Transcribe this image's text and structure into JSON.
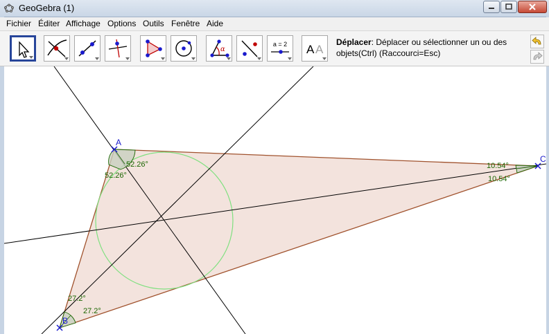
{
  "window": {
    "title": "GeoGebra (1)"
  },
  "menu": {
    "fichier": "Fichier",
    "editer": "Éditer",
    "affichage": "Affichage",
    "options": "Options",
    "outils": "Outils",
    "fenetre": "Fenêtre",
    "aide": "Aide"
  },
  "toolbar": {
    "text_tool_glyph_1": "A",
    "text_tool_glyph_2": "A",
    "slider_tool_label": "a = 2",
    "tool_help_title": "Déplacer",
    "tool_help_text": ": Déplacer ou sélectionner un ou des objets(Ctrl) (Raccourci=Esc)"
  },
  "geometry": {
    "points": {
      "A": "A",
      "B": "B",
      "C": "C"
    },
    "angles": {
      "A_1": "52.26°",
      "A_2": "52.26°",
      "B_1": "27.2°",
      "B_2": "27.2°",
      "C_1": "10.54°",
      "C_2": "10.54°"
    },
    "colors": {
      "triangle_fill": "#f3e3dd",
      "triangle_edge": "#a0522d",
      "incircle": "#7fe07f",
      "bisector": "#000000",
      "point": "#1a1acc",
      "angle_label": "#1a6600",
      "angle_fill": "#c8cfc0"
    }
  },
  "icons": {
    "move": "arrow-cursor-icon",
    "point": "point-intersection-icon",
    "line": "line-through-points-icon",
    "perpendicular": "perpendicular-line-icon",
    "polygon": "polygon-icon",
    "circle": "circle-center-point-icon",
    "angle": "angle-icon",
    "reflect": "reflect-point-icon",
    "slider": "slider-icon",
    "text": "text-icon",
    "undo": "undo-icon",
    "redo": "redo-icon"
  }
}
